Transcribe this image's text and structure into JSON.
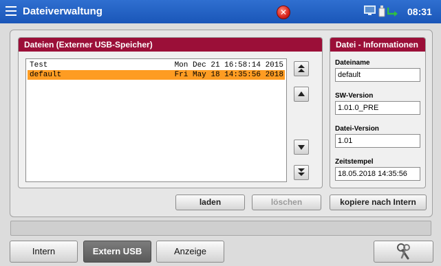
{
  "titlebar": {
    "menu_icon": "hamburger-menu-icon",
    "title": "Dateiverwaltung",
    "error_icon": "error-x-icon",
    "status_icons": [
      "monitor-icon",
      "usb-stick-icon",
      "usb-arrow-icon"
    ],
    "clock": "08:31",
    "colors": {
      "bar": "#1f5fc2",
      "error": "#d8231c",
      "usb": "#30c040"
    }
  },
  "files_panel": {
    "header": "Dateien (Externer USB-Speicher)",
    "header_color": "#9b0f38",
    "files": [
      {
        "name": "Test",
        "date": "Mon Dec 21 16:58:14 2015",
        "selected": false
      },
      {
        "name": "default",
        "date": "Fri May 18 14:35:56 2018",
        "selected": true
      }
    ],
    "selection_color": "#fe9c22",
    "scroll_buttons": [
      "scroll-top-icon",
      "scroll-up-icon",
      "scroll-down-icon",
      "scroll-bottom-icon"
    ]
  },
  "info_panel": {
    "header": "Datei - Informationen",
    "fields": [
      {
        "label": "Dateiname",
        "value": "default"
      },
      {
        "label": "SW-Version",
        "value": "1.01.0_PRE"
      },
      {
        "label": "Datei-Version",
        "value": "1.01"
      },
      {
        "label": "Zeitstempel",
        "value": "18.05.2018  14:35:56"
      }
    ]
  },
  "actions": {
    "load": "laden",
    "delete": "löschen",
    "copy_internal": "kopiere nach Intern"
  },
  "status_bar": {
    "text": ""
  },
  "bottom_tabs": {
    "intern": "Intern",
    "extern_usb": "Extern USB",
    "display": "Anzeige",
    "tools_icon": "wrench-icon"
  }
}
